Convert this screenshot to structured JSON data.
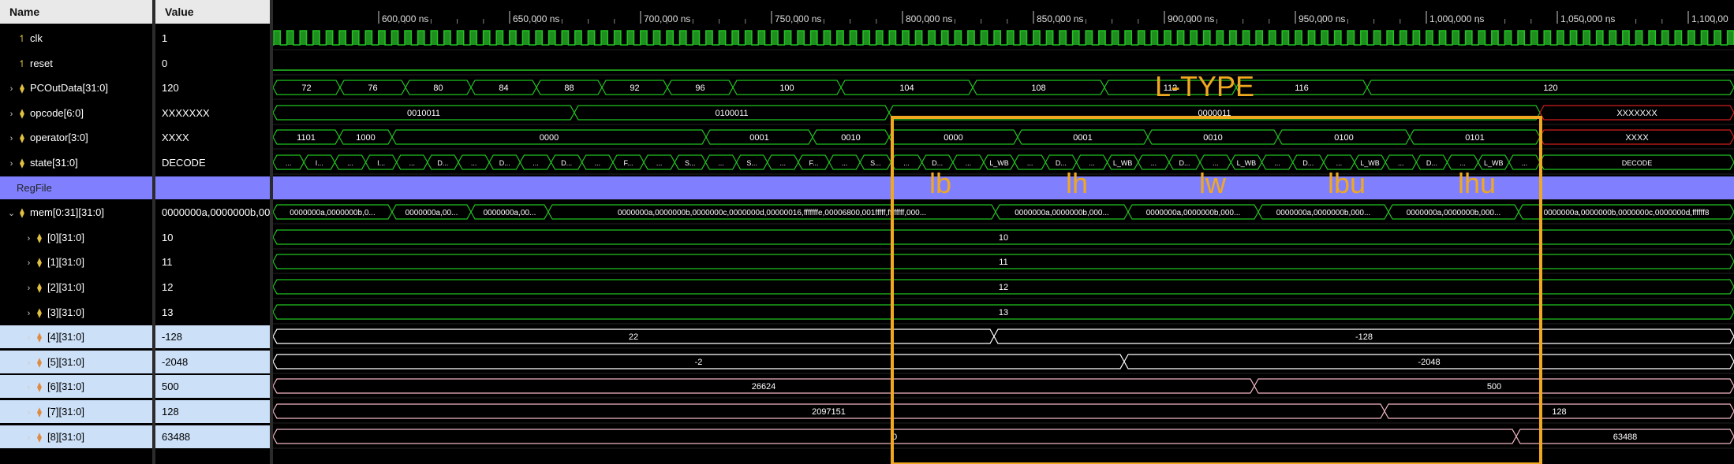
{
  "columns": {
    "name": "Name",
    "value": "Value"
  },
  "signals": [
    {
      "name": "clk",
      "value": "1",
      "icon": "clock-icon",
      "expand": false,
      "depth": 0
    },
    {
      "name": "reset",
      "value": "0",
      "icon": "clock-icon",
      "expand": false,
      "depth": 0
    },
    {
      "name": "PCOutData[31:0]",
      "value": "120",
      "icon": "bus-icon",
      "expand": true,
      "depth": 0
    },
    {
      "name": "opcode[6:0]",
      "value": "XXXXXXX",
      "icon": "bus-icon",
      "expand": true,
      "depth": 0
    },
    {
      "name": "operator[3:0]",
      "value": "XXXX",
      "icon": "bus-icon",
      "expand": true,
      "depth": 0
    },
    {
      "name": "state[31:0]",
      "value": "DECODE",
      "icon": "bus-icon",
      "expand": true,
      "depth": 0
    },
    {
      "name": "RegFile",
      "value": "",
      "icon": "",
      "expand": false,
      "depth": 0,
      "highlight": true
    },
    {
      "name": "mem[0:31][31:0]",
      "value": "0000000a,0000000b,00",
      "icon": "bus-icon",
      "expand": true,
      "expanded": true,
      "depth": 0
    },
    {
      "name": "[0][31:0]",
      "value": "10",
      "icon": "bus-icon",
      "expand": true,
      "depth": 1
    },
    {
      "name": "[1][31:0]",
      "value": "11",
      "icon": "bus-icon",
      "expand": true,
      "depth": 1
    },
    {
      "name": "[2][31:0]",
      "value": "12",
      "icon": "bus-icon",
      "expand": true,
      "depth": 1
    },
    {
      "name": "[3][31:0]",
      "value": "13",
      "icon": "bus-icon",
      "expand": true,
      "depth": 1
    },
    {
      "name": "[4][31:0]",
      "value": "-128",
      "icon": "bus-icon-orange",
      "expand": true,
      "depth": 1,
      "selected": true
    },
    {
      "name": "[5][31:0]",
      "value": "-2048",
      "icon": "bus-icon-orange",
      "expand": true,
      "depth": 1,
      "selected": true
    },
    {
      "name": "[6][31:0]",
      "value": "500",
      "icon": "bus-icon-orange",
      "expand": true,
      "depth": 1,
      "selected": true
    },
    {
      "name": "[7][31:0]",
      "value": "128",
      "icon": "bus-icon-orange",
      "expand": true,
      "depth": 1,
      "selected": true
    },
    {
      "name": "[8][31:0]",
      "value": "63488",
      "icon": "bus-icon-orange",
      "expand": true,
      "depth": 1,
      "selected": true
    }
  ],
  "time_ruler": [
    "600,000 ns",
    "650,000 ns",
    "700,000 ns",
    "750,000 ns",
    "800,000 ns",
    "850,000 ns",
    "900,000 ns",
    "950,000 ns",
    "1,000,000 ns",
    "1,050,000 ns",
    "1,100,00"
  ],
  "waves": {
    "pc": [
      "72",
      "76",
      "80",
      "84",
      "88",
      "92",
      "96",
      "100",
      "104",
      "108",
      "112",
      "116",
      "120"
    ],
    "opcode": [
      "0010011",
      "0100011",
      "0000011",
      "XXXXXXX"
    ],
    "operator": [
      "1101",
      "1000",
      "0000",
      "0001",
      "0010",
      "0000",
      "0001",
      "0010",
      "0100",
      "0101",
      "XXXX"
    ],
    "state_dots": [
      "...",
      "I...",
      "...",
      "I...",
      "...",
      "D...",
      "...",
      "D...",
      "...",
      "D...",
      "...",
      "F...",
      "...",
      "S...",
      "...",
      "S...",
      "...",
      "F...",
      "...",
      "S...",
      "...",
      "D...",
      "...",
      "L_WB",
      "...",
      "D...",
      "...",
      "L_WB",
      "...",
      "D...",
      "...",
      "L_WB",
      "...",
      "D...",
      "...",
      "L_WB",
      "...",
      "D...",
      "...",
      "L_WB",
      "...",
      "DECODE"
    ],
    "mem": [
      "0000000a,0000000b,0...",
      "0000000a,00...",
      "0000000a,00...",
      "0000000a,0000000b,0000000c,0000000d,00000016,fffffffe,00006800,001fffff,ffffffff,000...",
      "0000000a,0000000b,000...",
      "0000000a,0000000b,000...",
      "0000000a,0000000b,000...",
      "0000000a,0000000b,000...",
      "0000000a,0000000b,0000000c,0000000d,ffffff8"
    ],
    "m0": "10",
    "m1": "11",
    "m2": "12",
    "m3": "13",
    "m4": [
      "22",
      "-128"
    ],
    "m5": [
      "-2",
      "-2048"
    ],
    "m6": [
      "26624",
      "500"
    ],
    "m7": [
      "2097151",
      "128"
    ],
    "m8": [
      "0",
      "63488"
    ]
  },
  "annotation": {
    "title": "L-TYPE",
    "labels": [
      "lb",
      "lh",
      "lw",
      "lbu",
      "lhu"
    ],
    "color": "#f0a820"
  },
  "colors": {
    "green": "#21c421",
    "clock_fill": "#1e8f1e",
    "pink": "#f2b6c4",
    "white_wave": "#ffffff",
    "regfile": "#8080ff",
    "red": "#d21e1e"
  }
}
